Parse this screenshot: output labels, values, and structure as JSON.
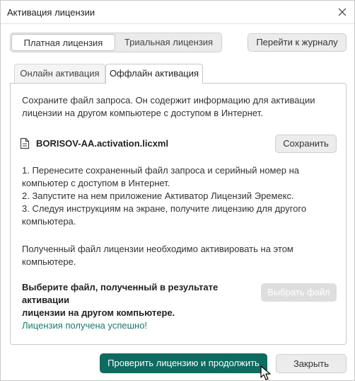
{
  "window": {
    "title": "Активация лицензии"
  },
  "license_type": {
    "paid_label": "Платная лицензия",
    "trial_label": "Триальная лицензия",
    "selected": "Платная лицензия"
  },
  "journal_button": "Перейти к журналу",
  "tabs": [
    {
      "label": "Онлайн активация",
      "active": false
    },
    {
      "label": "Оффлайн активация",
      "active": true
    }
  ],
  "offline": {
    "intro_lines": [
      "Сохраните файл запроса. Он содержит информацию для активации",
      "лицензии на другом компьютере с доступом в Интернет."
    ],
    "file_name": "BORISOV-AA.activation.licxml",
    "save_button": "Сохранить",
    "steps_lines": [
      "1. Перенесите сохраненный файл запроса и серийный номер на",
      "компьютер с доступом в Интернет.",
      "2. Запустите на нем приложение Активатор Лицензий Эремекс.",
      "3. Следуя инструкциям на экране, получите лицензию для другого",
      "компьютера."
    ],
    "note_lines": [
      "Полученный файл лицензии необходимо активировать на этом",
      "компьютере."
    ],
    "choose_label_lines": [
      "Выберите файл, полученный в результате активации",
      "лицензии на другом компьютере."
    ],
    "choose_button": "Выбрать файл",
    "status": "Лицензия получена успешно!"
  },
  "footer": {
    "primary_button": "Проверить лицензию и продолжить",
    "close_button": "Закрыть"
  },
  "colors": {
    "primary": "#0f6a60",
    "success_text": "#1d7a6d",
    "disabled_button": "#dedede"
  },
  "icons": [
    "close-icon",
    "file-icon",
    "mouse-cursor-icon"
  ]
}
